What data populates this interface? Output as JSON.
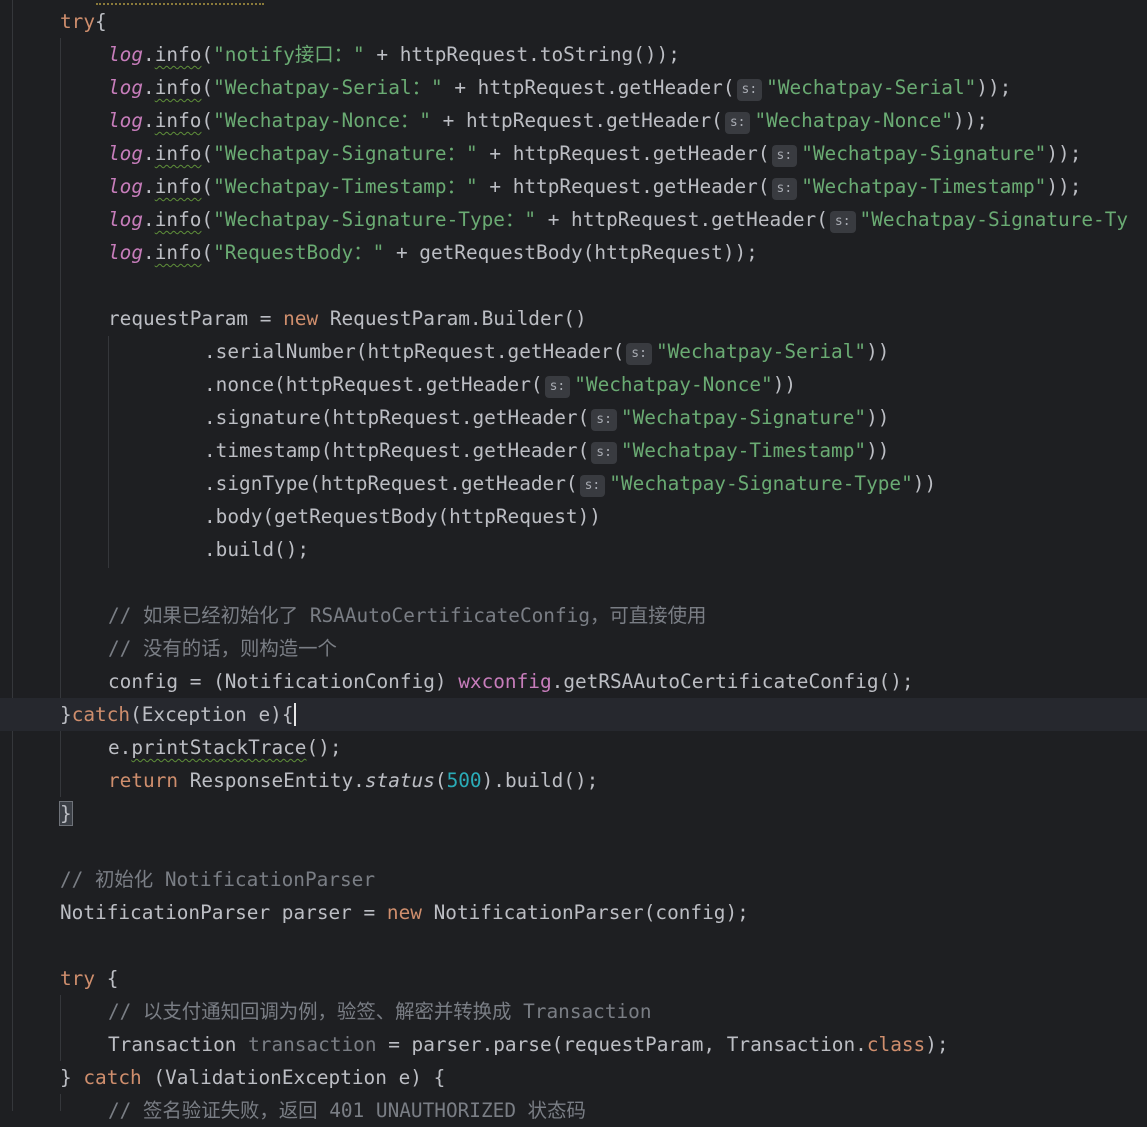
{
  "editor": {
    "lines": [
      {
        "tokens": [
          [
            "kw",
            "try"
          ],
          [
            "",
            "{"
          ]
        ]
      },
      {
        "tokens": [
          [
            "ital fld",
            "log"
          ],
          [
            "",
            "."
          ],
          [
            "typo",
            "info"
          ],
          [
            "",
            "("
          ],
          [
            "str",
            "\"notify接口：\""
          ],
          [
            "",
            " + httpRequest.toString());"
          ]
        ]
      },
      {
        "tokens": [
          [
            "ital fld",
            "log"
          ],
          [
            "",
            "."
          ],
          [
            "typo",
            "info"
          ],
          [
            "",
            "("
          ],
          [
            "str",
            "\"Wechatpay-Serial：\""
          ],
          [
            "",
            " + httpRequest.getHeader("
          ],
          [
            "hint",
            "s:"
          ],
          [
            "str",
            "\"Wechatpay-Serial\""
          ],
          [
            "",
            "));"
          ]
        ]
      },
      {
        "tokens": [
          [
            "ital fld",
            "log"
          ],
          [
            "",
            "."
          ],
          [
            "typo",
            "info"
          ],
          [
            "",
            "("
          ],
          [
            "str",
            "\"Wechatpay-Nonce：\""
          ],
          [
            "",
            " + httpRequest.getHeader("
          ],
          [
            "hint",
            "s:"
          ],
          [
            "str",
            "\"Wechatpay-Nonce\""
          ],
          [
            "",
            "));"
          ]
        ]
      },
      {
        "tokens": [
          [
            "ital fld",
            "log"
          ],
          [
            "",
            "."
          ],
          [
            "typo",
            "info"
          ],
          [
            "",
            "("
          ],
          [
            "str",
            "\"Wechatpay-Signature：\""
          ],
          [
            "",
            " + httpRequest.getHeader("
          ],
          [
            "hint",
            "s:"
          ],
          [
            "str",
            "\"Wechatpay-Signature\""
          ],
          [
            "",
            "));"
          ]
        ]
      },
      {
        "tokens": [
          [
            "ital fld",
            "log"
          ],
          [
            "",
            "."
          ],
          [
            "typo",
            "info"
          ],
          [
            "",
            "("
          ],
          [
            "str",
            "\"Wechatpay-Timestamp：\""
          ],
          [
            "",
            " + httpRequest.getHeader("
          ],
          [
            "hint",
            "s:"
          ],
          [
            "str",
            "\"Wechatpay-Timestamp\""
          ],
          [
            "",
            "));"
          ]
        ]
      },
      {
        "tokens": [
          [
            "ital fld",
            "log"
          ],
          [
            "",
            "."
          ],
          [
            "typo",
            "info"
          ],
          [
            "",
            "("
          ],
          [
            "str",
            "\"Wechatpay-Signature-Type：\""
          ],
          [
            "",
            " + httpRequest.getHeader("
          ],
          [
            "hint",
            "s:"
          ],
          [
            "str",
            "\"Wechatpay-Signature-Ty"
          ]
        ]
      },
      {
        "tokens": [
          [
            "ital fld",
            "log"
          ],
          [
            "",
            "."
          ],
          [
            "typo",
            "info"
          ],
          [
            "",
            "("
          ],
          [
            "str",
            "\"RequestBody：\""
          ],
          [
            "",
            " + getRequestBody(httpRequest));"
          ]
        ]
      },
      {
        "tokens": []
      },
      {
        "tokens": [
          [
            "",
            "requestParam = "
          ],
          [
            "kw",
            "new"
          ],
          [
            "",
            " RequestParam.Builder()"
          ]
        ]
      },
      {
        "tokens": [
          [
            "",
            ".serialNumber(httpRequest.getHeader("
          ],
          [
            "hint",
            "s:"
          ],
          [
            "str",
            "\"Wechatpay-Serial\""
          ],
          [
            "",
            "))"
          ]
        ]
      },
      {
        "tokens": [
          [
            "",
            ".nonce(httpRequest.getHeader("
          ],
          [
            "hint",
            "s:"
          ],
          [
            "str",
            "\"Wechatpay-Nonce\""
          ],
          [
            "",
            "))"
          ]
        ]
      },
      {
        "tokens": [
          [
            "",
            ".signature(httpRequest.getHeader("
          ],
          [
            "hint",
            "s:"
          ],
          [
            "str",
            "\"Wechatpay-Signature\""
          ],
          [
            "",
            "))"
          ]
        ]
      },
      {
        "tokens": [
          [
            "",
            ".timestamp(httpRequest.getHeader("
          ],
          [
            "hint",
            "s:"
          ],
          [
            "str",
            "\"Wechatpay-Timestamp\""
          ],
          [
            "",
            "))"
          ]
        ]
      },
      {
        "tokens": [
          [
            "",
            ".signType(httpRequest.getHeader("
          ],
          [
            "hint",
            "s:"
          ],
          [
            "str",
            "\"Wechatpay-Signature-Type\""
          ],
          [
            "",
            "))"
          ]
        ]
      },
      {
        "tokens": [
          [
            "",
            ".body(getRequestBody(httpRequest))"
          ]
        ]
      },
      {
        "tokens": [
          [
            "",
            ".build();"
          ]
        ]
      },
      {
        "tokens": []
      },
      {
        "tokens": [
          [
            "cm",
            "// 如果已经初始化了 RSAAutoCertificateConfig，可直接使用"
          ]
        ]
      },
      {
        "tokens": [
          [
            "cm",
            "// 没有的话，则构造一个"
          ]
        ]
      },
      {
        "tokens": [
          [
            "",
            "config = (NotificationConfig) "
          ],
          [
            "fld",
            "wxconfig"
          ],
          [
            "",
            ".getRSAAutoCertificateConfig();"
          ]
        ]
      },
      {
        "tokens": [
          [
            "",
            "}"
          ],
          [
            "kw",
            "catch"
          ],
          [
            "",
            "(Exception e)"
          ],
          [
            "cursor-brace",
            "{"
          ]
        ]
      },
      {
        "tokens": [
          [
            "",
            "e."
          ],
          [
            "typo",
            "printStackTrace"
          ],
          [
            "",
            "();"
          ]
        ]
      },
      {
        "tokens": [
          [
            "kw",
            "return"
          ],
          [
            "",
            " ResponseEntity."
          ],
          [
            "ital",
            "status"
          ],
          [
            "",
            "("
          ],
          [
            "num",
            "500"
          ],
          [
            "",
            ").build();"
          ]
        ]
      },
      {
        "tokens": [
          [
            "brace-hl",
            "}"
          ]
        ]
      },
      {
        "tokens": []
      },
      {
        "tokens": [
          [
            "cm",
            "// 初始化 NotificationParser"
          ]
        ]
      },
      {
        "tokens": [
          [
            "",
            "NotificationParser parser = "
          ],
          [
            "kw",
            "new"
          ],
          [
            "",
            " NotificationParser(config);"
          ]
        ]
      },
      {
        "tokens": []
      },
      {
        "tokens": [
          [
            "kw",
            "try"
          ],
          [
            "",
            " {"
          ]
        ]
      },
      {
        "tokens": [
          [
            "cm",
            "// 以支付通知回调为例，验签、解密并转换成 Transaction"
          ]
        ]
      },
      {
        "tokens": [
          [
            "",
            "Transaction "
          ],
          [
            "dim",
            "transaction"
          ],
          [
            "",
            " = parser.parse(requestParam, Transaction."
          ],
          [
            "kw",
            "class"
          ],
          [
            "",
            ");"
          ]
        ]
      },
      {
        "tokens": [
          [
            "",
            "} "
          ],
          [
            "kw",
            "catch"
          ],
          [
            "",
            " (ValidationException e) {"
          ]
        ]
      },
      {
        "tokens": [
          [
            "cm",
            "// 签名验证失败，返回 401 UNAUTHORIZED 状态码"
          ]
        ]
      }
    ]
  }
}
